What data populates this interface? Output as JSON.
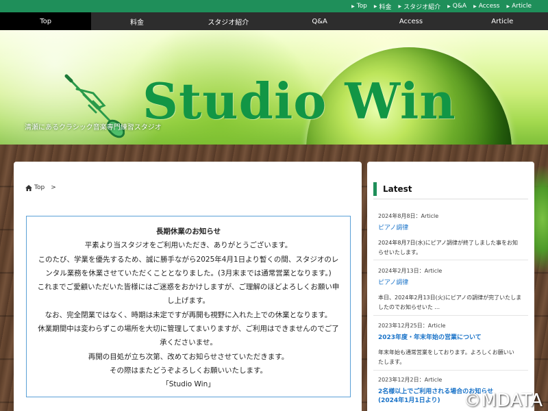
{
  "utility_nav": [
    "Top",
    "料金",
    "スタジオ紹介",
    "Q&A",
    "Access",
    "Article"
  ],
  "global_nav": [
    "Top",
    "料金",
    "スタジオ紹介",
    "Q&A",
    "Access",
    "Article"
  ],
  "hero": {
    "logo": "Studio Win",
    "tagline": "清瀬にあるクラシック音楽専門練習スタジオ"
  },
  "breadcrumb": {
    "home": "Top",
    "separator": ">"
  },
  "notice": {
    "title": "長期休業のお知らせ",
    "lines": [
      "平素より当スタジオをご利用いただき、ありがとうございます。",
      "このたび、学業を優先するため、誠に勝手ながら2025年4月1日より暫くの間、スタジオのレ",
      "ンタル業務を休業させていただくこととなりました。(3月末までは通常営業となります。)",
      "これまでご愛顧いただいた皆様にはご迷惑をおかけしますが、ご理解のほどよろしくお願い申",
      "し上げます。",
      "なお、完全閉業ではなく、時期は未定ですが再開も視野に入れた上での休業となります。",
      "休業期間中は変わらずこの場所を大切に管理してまいりますが、ご利用はできませんのでご了",
      "承くださいませ。",
      "再開の目処が立ち次第、改めてお知らせさせていただきます。",
      "その際はまたどうぞよろしくお願いいたします。",
      "「Studio Win」"
    ]
  },
  "sidebar": {
    "heading": "Latest",
    "posts": [
      {
        "meta": "2024年8月8日：Article",
        "title": "ピアノ調律",
        "excerpt": [
          "2024年8月7日(水)にピアノ調律が終了しました事をお知",
          "らせいたします。"
        ]
      },
      {
        "meta": "2024年2月13日：Article",
        "title": "ピアノ調律",
        "excerpt": [
          "本日、2024年2月13日(火)にピアノの調律が完了いたしま",
          "したのでお知らせいた ..."
        ]
      },
      {
        "meta": "2023年12月25日：Article",
        "title": "2023年度・年末年始の営業について",
        "excerpt": [
          "年末年始も通常営業をしております。よろしくお願いい",
          "たします。"
        ]
      },
      {
        "meta": "2023年12月2日：Article",
        "title": "2名様以上でご利用される場合のお知らせ\n(2024年1月1日より)",
        "excerpt": []
      }
    ]
  },
  "watermark": "©MDATA",
  "colors": {
    "brand_green": "#1f8f5a",
    "logo_green": "#129645",
    "link_blue": "#1a73c8",
    "nav_dark": "#2d2d2d"
  }
}
